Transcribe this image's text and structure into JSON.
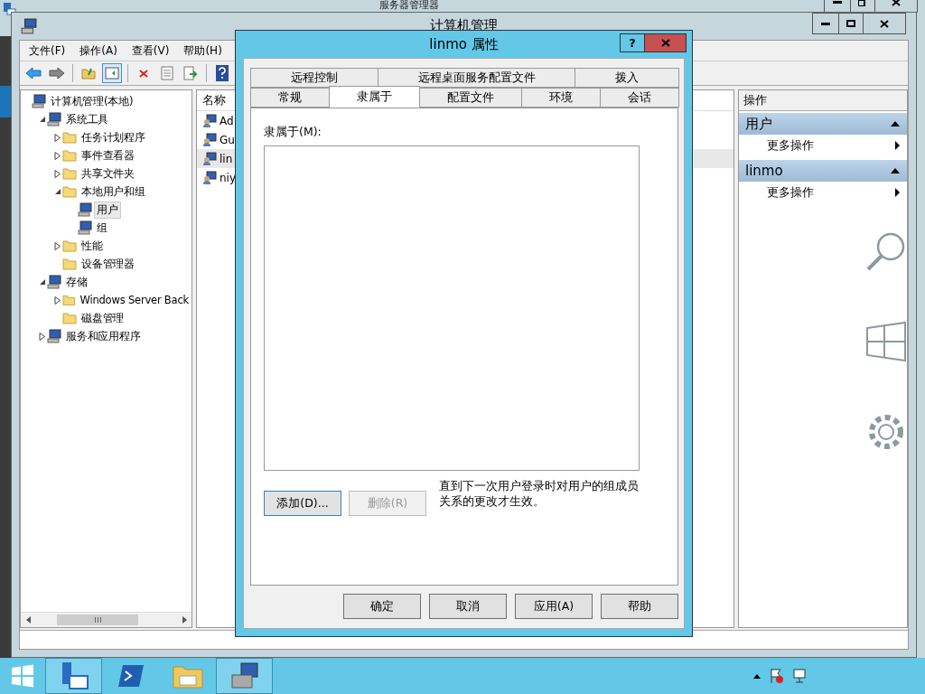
{
  "background_window": {
    "title": "服务器管理器"
  },
  "window": {
    "title": "计算机管理"
  },
  "menu": [
    "文件(F)",
    "操作(A)",
    "查看(V)",
    "帮助(H)"
  ],
  "tree": [
    {
      "label": "计算机管理(本地)",
      "selected": false,
      "children": [
        {
          "label": "系统工具",
          "expanded": true,
          "selected": false,
          "children": [
            {
              "label": "任务计划程序",
              "expanded": false,
              "selected": false
            },
            {
              "label": "事件查看器",
              "expanded": false,
              "selected": false
            },
            {
              "label": "共享文件夹",
              "expanded": false,
              "selected": false
            },
            {
              "label": "本地用户和组",
              "expanded": true,
              "selected": false,
              "children": [
                {
                  "label": "用户",
                  "selected": true
                },
                {
                  "label": "组",
                  "selected": false
                }
              ]
            },
            {
              "label": "性能",
              "expanded": false,
              "selected": false
            },
            {
              "label": "设备管理器",
              "selected": false
            }
          ]
        },
        {
          "label": "存储",
          "expanded": true,
          "selected": false,
          "children": [
            {
              "label": "Windows Server Back",
              "expanded": false,
              "selected": false
            },
            {
              "label": "磁盘管理",
              "selected": false
            }
          ]
        },
        {
          "label": "服务和应用程序",
          "expanded": false,
          "selected": false
        }
      ]
    }
  ],
  "list": {
    "column_1": "名称",
    "rows": [
      {
        "name": "Ad",
        "selected": false
      },
      {
        "name": "Gu",
        "selected": false
      },
      {
        "name": "lin",
        "selected": true
      },
      {
        "name": "niy",
        "selected": false
      }
    ]
  },
  "actions": {
    "title": "操作",
    "sections": [
      {
        "title": "用户",
        "items": [
          "更多操作"
        ]
      },
      {
        "title": "linmo",
        "items": [
          "更多操作"
        ]
      }
    ]
  },
  "dialog": {
    "title": "linmo 属性",
    "help_button": "?",
    "tab_rows": [
      [
        {
          "label": "远程控制",
          "selected": false
        },
        {
          "label": "远程桌面服务配置文件",
          "selected": false
        },
        {
          "label": "拨入",
          "selected": false
        }
      ],
      [
        {
          "label": "常规",
          "selected": false
        },
        {
          "label": "隶属于",
          "selected": true
        },
        {
          "label": "配置文件",
          "selected": false
        },
        {
          "label": "环境",
          "selected": false
        },
        {
          "label": "会话",
          "selected": false
        }
      ]
    ],
    "member_label": "隶属于(M):",
    "buttons": [
      {
        "label": "添加(D)...",
        "disabled": false
      },
      {
        "label": "删除(R)",
        "disabled": true
      }
    ],
    "note": "直到下一次用户登录时对用户的组成员关系的更改才生效。",
    "footer_buttons": [
      "确定",
      "取消",
      "应用(A)",
      "帮助"
    ]
  }
}
